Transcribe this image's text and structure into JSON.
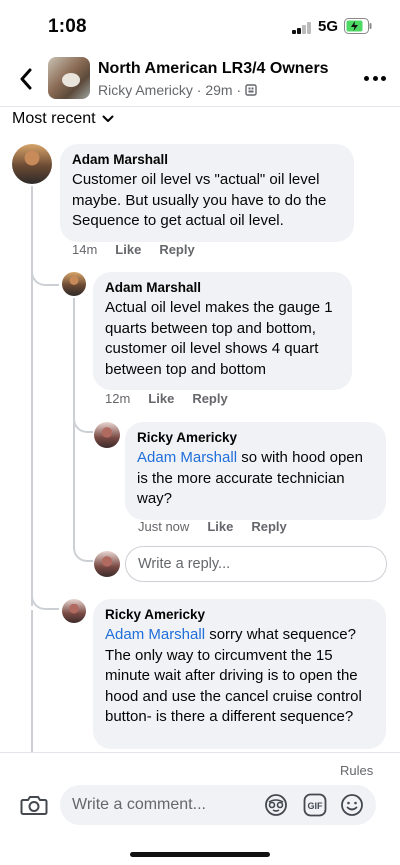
{
  "status": {
    "time": "1:08",
    "network": "5G"
  },
  "header": {
    "title": "North American LR3/4 Owners",
    "subtitle": "Ricky Americky · 29m ·",
    "back_icon": "chevron-left-icon",
    "more_icon": "more-horizontal-icon"
  },
  "sort": {
    "label": "Most recent"
  },
  "comments": [
    {
      "author": "Adam Marshall",
      "mention": "",
      "text": "Customer oil level vs \"actual\" oil level maybe.  But usually you have to do the Sequence to get actual oil level.",
      "time": "14m",
      "like": "Like",
      "reply": "Reply"
    },
    {
      "author": "Adam Marshall",
      "mention": "",
      "text": "Actual oil level makes the gauge 1 quarts between top and bottom, customer oil level shows 4 quart between top and bottom",
      "time": "12m",
      "like": "Like",
      "reply": "Reply"
    },
    {
      "author": "Ricky Americky",
      "mention": "Adam Marshall",
      "text": " so with hood open is the more accurate technician way?",
      "time": "Just now",
      "like": "Like",
      "reply": "Reply"
    },
    {
      "author": "Ricky Americky",
      "mention": "Adam Marshall",
      "text": " sorry what sequence? The only way to circumvent the 15 minute wait after driving is to open the hood and use the cancel cruise control button- is there a different sequence?",
      "time": "",
      "like": "",
      "reply": ""
    }
  ],
  "reply_box": {
    "placeholder": "Write a reply..."
  },
  "footer": {
    "rules": "Rules",
    "comment_placeholder": "Write a comment...",
    "gif_label": "GIF"
  }
}
